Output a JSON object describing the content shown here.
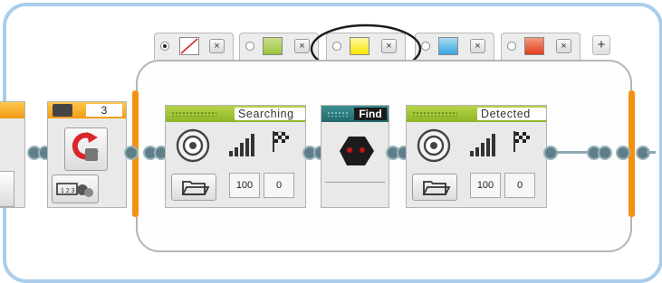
{
  "switch_tabs": [
    {
      "name": "tab-no-color",
      "swatch": "none",
      "selected": true
    },
    {
      "name": "tab-green",
      "swatch": "#9bc53d",
      "selected": false
    },
    {
      "name": "tab-yellow",
      "swatch": "#f6e600",
      "selected": false,
      "highlighted": true
    },
    {
      "name": "tab-blue",
      "swatch": "#3aa7e0",
      "selected": false
    },
    {
      "name": "tab-red",
      "swatch": "#e23b1b",
      "selected": false
    }
  ],
  "tab_close_symbol": "×",
  "add_case_symbol": "+",
  "loop_counter": "3",
  "searching_label": "Searching",
  "find_label": "Find",
  "detected_label": "Detected",
  "sound_searching": {
    "volume": "100",
    "play_type": "0"
  },
  "sound_detected": {
    "volume": "100",
    "play_type": "0"
  },
  "colors": {
    "frame": "#a9cdea",
    "accent_orange": "#f29114",
    "sound_green": "#9bc53d",
    "teal": "#2f7f82"
  }
}
